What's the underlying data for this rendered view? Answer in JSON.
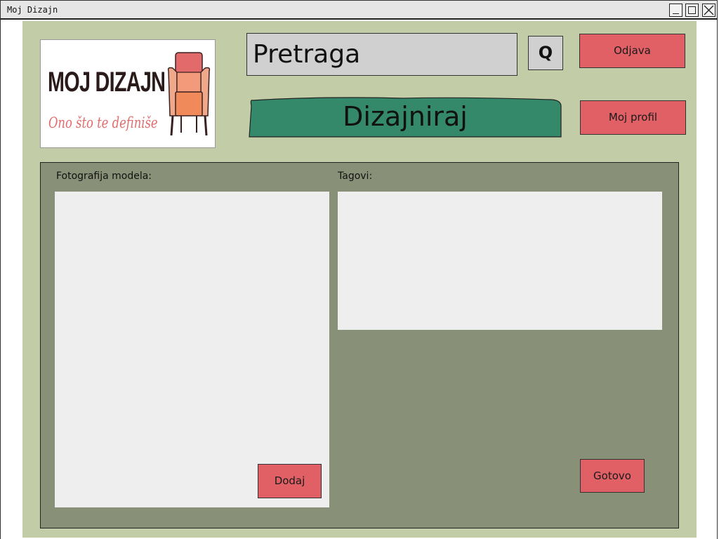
{
  "window": {
    "title": "Moj Dizajn"
  },
  "logo": {
    "title": "MOJ DIZAJN",
    "tagline": "Ono što te definiše"
  },
  "search": {
    "placeholder": "Pretraga",
    "button_label": "Q"
  },
  "header": {
    "logout_label": "Odjava",
    "profile_label": "Moj profil",
    "design_label": "Dizajniraj"
  },
  "form": {
    "photo_label": "Fotografija modela:",
    "tags_label": "Tagovi:",
    "add_label": "Dodaj",
    "done_label": "Gotovo"
  },
  "colors": {
    "canvas": "#c2cda7",
    "panel": "#889077",
    "accent_red": "#e06066",
    "accent_green": "#34896a"
  }
}
